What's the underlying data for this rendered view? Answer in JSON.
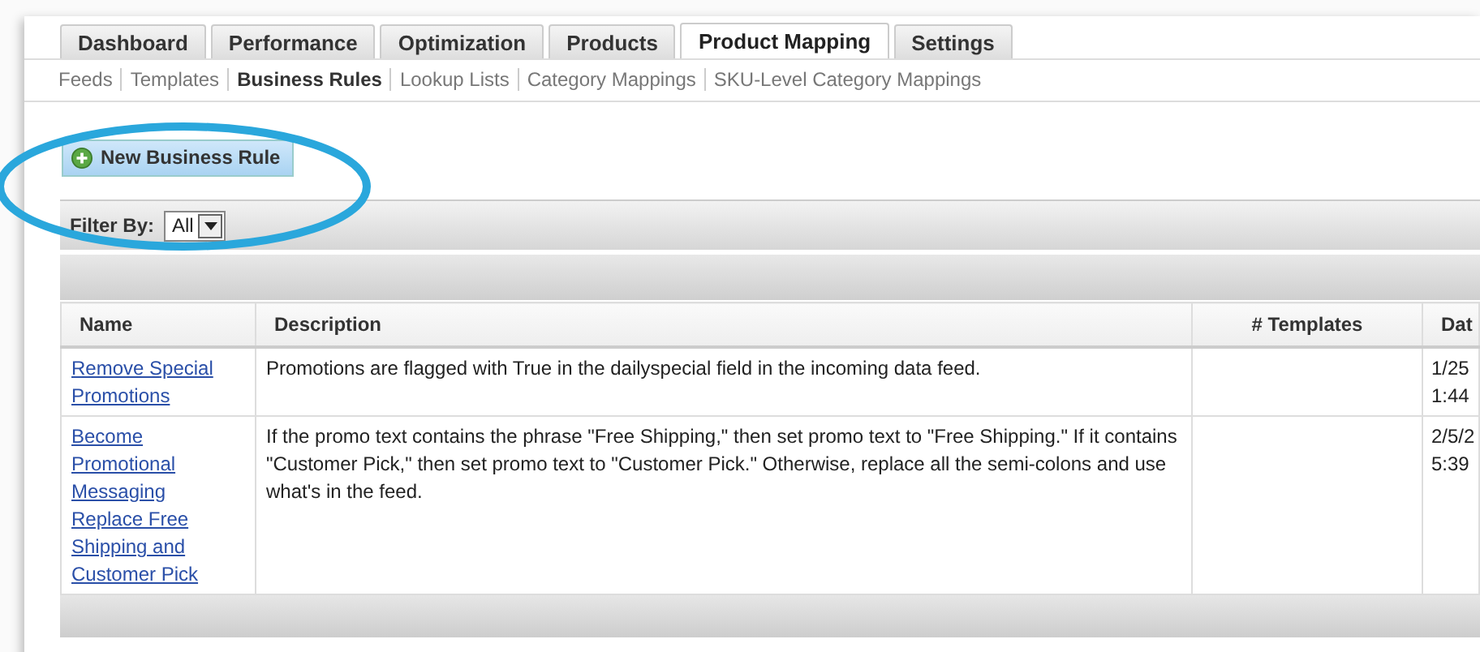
{
  "tabs": [
    {
      "label": "Dashboard",
      "selected": false
    },
    {
      "label": "Performance",
      "selected": false
    },
    {
      "label": "Optimization",
      "selected": false
    },
    {
      "label": "Products",
      "selected": false
    },
    {
      "label": "Product Mapping",
      "selected": true
    },
    {
      "label": "Settings",
      "selected": false
    }
  ],
  "subnav": [
    {
      "label": "Feeds",
      "selected": false
    },
    {
      "label": "Templates",
      "selected": false
    },
    {
      "label": "Business Rules",
      "selected": true
    },
    {
      "label": "Lookup Lists",
      "selected": false
    },
    {
      "label": "Category Mappings",
      "selected": false
    },
    {
      "label": "SKU-Level Category Mappings",
      "selected": false
    }
  ],
  "new_button": {
    "label": "New Business Rule"
  },
  "filter": {
    "label": "Filter By:",
    "value": "All"
  },
  "table": {
    "columns": [
      "Name",
      "Description",
      "# Templates",
      "Dat"
    ],
    "rows": [
      {
        "name": "Remove Special Promotions",
        "description": "Promotions are flagged with True in the dailyspecial field in the incoming data feed.",
        "templates": "",
        "date": [
          "1/25",
          "1:44"
        ]
      },
      {
        "name": "Become Promotional Messaging Replace Free Shipping and Customer Pick",
        "description": "If the promo text contains the phrase \"Free Shipping,\" then set promo text to \"Free Shipping.\" If it contains \"Customer Pick,\" then set promo text to \"Customer Pick.\" Otherwise, replace all the semi-colons and use what's in the feed.",
        "templates": "",
        "date": [
          "2/5/2",
          "5:39"
        ]
      }
    ]
  }
}
